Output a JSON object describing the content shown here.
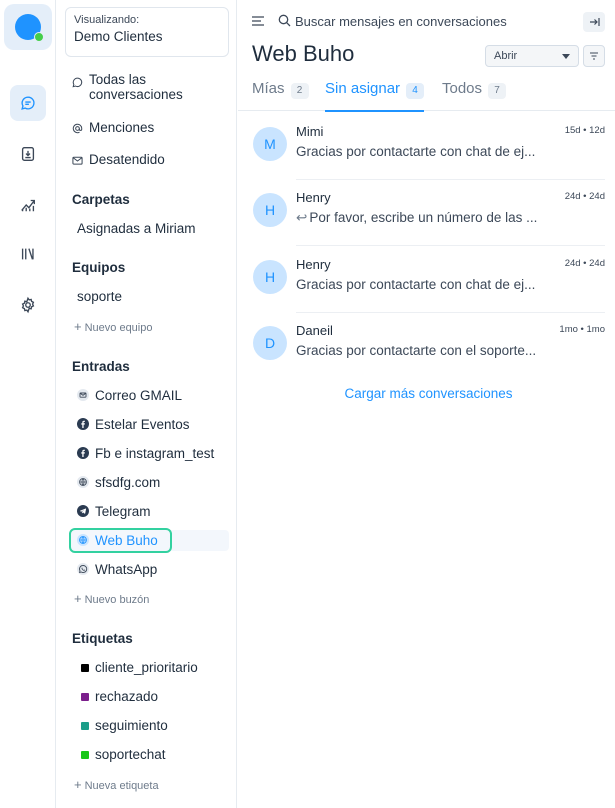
{
  "rail": {
    "icons": [
      "conversations-icon",
      "contacts-icon",
      "reports-icon",
      "campaigns-icon",
      "settings-icon"
    ],
    "active": "conversations-icon",
    "brand_color": "#1f93ff",
    "online_color": "#44ce4b"
  },
  "sidebar": {
    "viewing": {
      "label": "Visualizando:",
      "value": "Demo Clientes"
    },
    "nav": [
      {
        "label": "Todas las conversaciones",
        "icon": "chat-bubble-icon"
      },
      {
        "label": "Menciones",
        "icon": "at-icon"
      },
      {
        "label": "Desatendido",
        "icon": "mail-icon"
      }
    ],
    "folders": {
      "title": "Carpetas",
      "items": [
        "Asignadas a Miriam"
      ]
    },
    "teams": {
      "title": "Equipos",
      "items": [
        "soporte"
      ],
      "add_label": "Nuevo equipo"
    },
    "inboxes": {
      "title": "Entradas",
      "items": [
        {
          "label": "Correo GMAIL",
          "icon": "email-icon"
        },
        {
          "label": "Estelar Eventos",
          "icon": "facebook-icon"
        },
        {
          "label": "Fb e instagram_test",
          "icon": "facebook-icon"
        },
        {
          "label": "sfsdfg.com",
          "icon": "globe-icon"
        },
        {
          "label": "Telegram",
          "icon": "telegram-icon"
        },
        {
          "label": "Web Buho",
          "icon": "globe-icon",
          "active": true
        },
        {
          "label": "WhatsApp",
          "icon": "whatsapp-icon"
        }
      ],
      "add_label": "Nuevo buzón"
    },
    "labels": {
      "title": "Etiquetas",
      "items": [
        {
          "label": "cliente_prioritario",
          "color": "#000000"
        },
        {
          "label": "rechazado",
          "color": "#7b1f8c"
        },
        {
          "label": "seguimiento",
          "color": "#1b9e89"
        },
        {
          "label": "soportechat",
          "color": "#18c718"
        }
      ],
      "add_label": "Nueva etiqueta"
    }
  },
  "main": {
    "search": {
      "placeholder": "Buscar mensajes en conversaciones"
    },
    "title": "Web Buho",
    "status_filter": "Abrir",
    "tabs": [
      {
        "label": "Mías",
        "count": "2"
      },
      {
        "label": "Sin asignar",
        "count": "4",
        "active": true
      },
      {
        "label": "Todos",
        "count": "7"
      }
    ],
    "conversations": [
      {
        "initial": "M",
        "name": "Mimi",
        "time": "15d • 12d",
        "message": "Gracias por contactarte con chat de ej...",
        "is_reply": false
      },
      {
        "initial": "H",
        "name": "Henry",
        "time": "24d • 24d",
        "message": "Por favor, escribe un número de las ...",
        "is_reply": true
      },
      {
        "initial": "H",
        "name": "Henry",
        "time": "24d • 24d",
        "message": "Gracias por contactarte con chat de ej...",
        "is_reply": false
      },
      {
        "initial": "D",
        "name": "Daneil",
        "time": "1mo • 1mo",
        "message": "Gracias por contactarte con el soporte...",
        "is_reply": false
      }
    ],
    "load_more": "Cargar más conversaciones",
    "accent_color": "#1f93ff"
  }
}
